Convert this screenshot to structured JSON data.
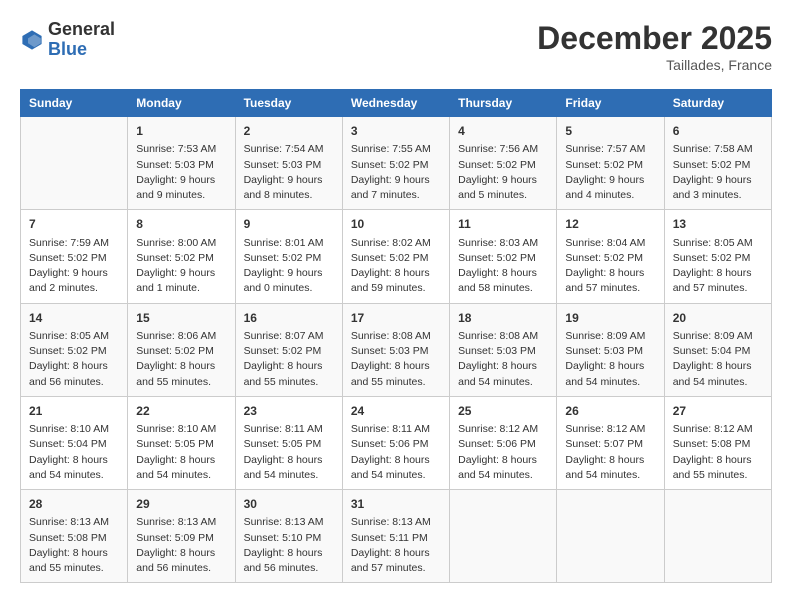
{
  "header": {
    "logo_general": "General",
    "logo_blue": "Blue",
    "month_title": "December 2025",
    "subtitle": "Taillades, France"
  },
  "columns": [
    "Sunday",
    "Monday",
    "Tuesday",
    "Wednesday",
    "Thursday",
    "Friday",
    "Saturday"
  ],
  "weeks": [
    [
      {
        "day": "",
        "info": ""
      },
      {
        "day": "1",
        "info": "Sunrise: 7:53 AM\nSunset: 5:03 PM\nDaylight: 9 hours\nand 9 minutes."
      },
      {
        "day": "2",
        "info": "Sunrise: 7:54 AM\nSunset: 5:03 PM\nDaylight: 9 hours\nand 8 minutes."
      },
      {
        "day": "3",
        "info": "Sunrise: 7:55 AM\nSunset: 5:02 PM\nDaylight: 9 hours\nand 7 minutes."
      },
      {
        "day": "4",
        "info": "Sunrise: 7:56 AM\nSunset: 5:02 PM\nDaylight: 9 hours\nand 5 minutes."
      },
      {
        "day": "5",
        "info": "Sunrise: 7:57 AM\nSunset: 5:02 PM\nDaylight: 9 hours\nand 4 minutes."
      },
      {
        "day": "6",
        "info": "Sunrise: 7:58 AM\nSunset: 5:02 PM\nDaylight: 9 hours\nand 3 minutes."
      }
    ],
    [
      {
        "day": "7",
        "info": "Sunrise: 7:59 AM\nSunset: 5:02 PM\nDaylight: 9 hours\nand 2 minutes."
      },
      {
        "day": "8",
        "info": "Sunrise: 8:00 AM\nSunset: 5:02 PM\nDaylight: 9 hours\nand 1 minute."
      },
      {
        "day": "9",
        "info": "Sunrise: 8:01 AM\nSunset: 5:02 PM\nDaylight: 9 hours\nand 0 minutes."
      },
      {
        "day": "10",
        "info": "Sunrise: 8:02 AM\nSunset: 5:02 PM\nDaylight: 8 hours\nand 59 minutes."
      },
      {
        "day": "11",
        "info": "Sunrise: 8:03 AM\nSunset: 5:02 PM\nDaylight: 8 hours\nand 58 minutes."
      },
      {
        "day": "12",
        "info": "Sunrise: 8:04 AM\nSunset: 5:02 PM\nDaylight: 8 hours\nand 57 minutes."
      },
      {
        "day": "13",
        "info": "Sunrise: 8:05 AM\nSunset: 5:02 PM\nDaylight: 8 hours\nand 57 minutes."
      }
    ],
    [
      {
        "day": "14",
        "info": "Sunrise: 8:05 AM\nSunset: 5:02 PM\nDaylight: 8 hours\nand 56 minutes."
      },
      {
        "day": "15",
        "info": "Sunrise: 8:06 AM\nSunset: 5:02 PM\nDaylight: 8 hours\nand 55 minutes."
      },
      {
        "day": "16",
        "info": "Sunrise: 8:07 AM\nSunset: 5:02 PM\nDaylight: 8 hours\nand 55 minutes."
      },
      {
        "day": "17",
        "info": "Sunrise: 8:08 AM\nSunset: 5:03 PM\nDaylight: 8 hours\nand 55 minutes."
      },
      {
        "day": "18",
        "info": "Sunrise: 8:08 AM\nSunset: 5:03 PM\nDaylight: 8 hours\nand 54 minutes."
      },
      {
        "day": "19",
        "info": "Sunrise: 8:09 AM\nSunset: 5:03 PM\nDaylight: 8 hours\nand 54 minutes."
      },
      {
        "day": "20",
        "info": "Sunrise: 8:09 AM\nSunset: 5:04 PM\nDaylight: 8 hours\nand 54 minutes."
      }
    ],
    [
      {
        "day": "21",
        "info": "Sunrise: 8:10 AM\nSunset: 5:04 PM\nDaylight: 8 hours\nand 54 minutes."
      },
      {
        "day": "22",
        "info": "Sunrise: 8:10 AM\nSunset: 5:05 PM\nDaylight: 8 hours\nand 54 minutes."
      },
      {
        "day": "23",
        "info": "Sunrise: 8:11 AM\nSunset: 5:05 PM\nDaylight: 8 hours\nand 54 minutes."
      },
      {
        "day": "24",
        "info": "Sunrise: 8:11 AM\nSunset: 5:06 PM\nDaylight: 8 hours\nand 54 minutes."
      },
      {
        "day": "25",
        "info": "Sunrise: 8:12 AM\nSunset: 5:06 PM\nDaylight: 8 hours\nand 54 minutes."
      },
      {
        "day": "26",
        "info": "Sunrise: 8:12 AM\nSunset: 5:07 PM\nDaylight: 8 hours\nand 54 minutes."
      },
      {
        "day": "27",
        "info": "Sunrise: 8:12 AM\nSunset: 5:08 PM\nDaylight: 8 hours\nand 55 minutes."
      }
    ],
    [
      {
        "day": "28",
        "info": "Sunrise: 8:13 AM\nSunset: 5:08 PM\nDaylight: 8 hours\nand 55 minutes."
      },
      {
        "day": "29",
        "info": "Sunrise: 8:13 AM\nSunset: 5:09 PM\nDaylight: 8 hours\nand 56 minutes."
      },
      {
        "day": "30",
        "info": "Sunrise: 8:13 AM\nSunset: 5:10 PM\nDaylight: 8 hours\nand 56 minutes."
      },
      {
        "day": "31",
        "info": "Sunrise: 8:13 AM\nSunset: 5:11 PM\nDaylight: 8 hours\nand 57 minutes."
      },
      {
        "day": "",
        "info": ""
      },
      {
        "day": "",
        "info": ""
      },
      {
        "day": "",
        "info": ""
      }
    ]
  ]
}
